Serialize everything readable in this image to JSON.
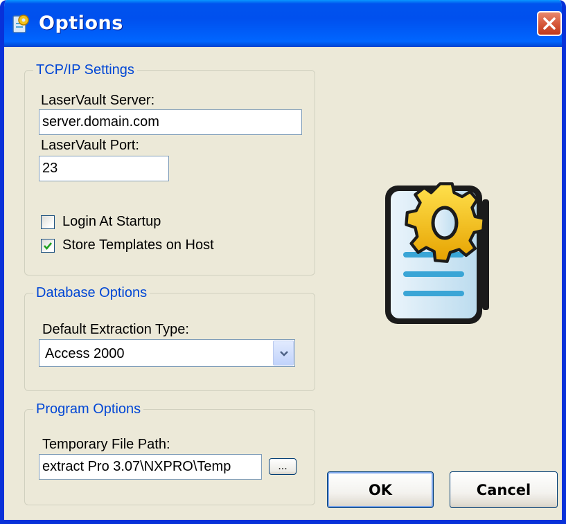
{
  "window": {
    "title": "Options",
    "icon": "options-app-icon",
    "close_icon": "close-icon"
  },
  "tcpip": {
    "legend": "TCP/IP Settings",
    "server_label": "LaserVault Server:",
    "server_value": "server.domain.com",
    "port_label": "LaserVault Port:",
    "port_value": "23",
    "login_at_startup_label": "Login At Startup",
    "login_at_startup_checked": false,
    "store_templates_label": "Store Templates on Host",
    "store_templates_checked": true
  },
  "database": {
    "legend": "Database Options",
    "extraction_type_label": "Default Extraction Type:",
    "extraction_type_value": "Access 2000"
  },
  "program": {
    "legend": "Program Options",
    "temp_path_label": "Temporary File Path:",
    "temp_path_value": "extract Pro 3.07\\NXPRO\\Temp",
    "browse_label": "..."
  },
  "buttons": {
    "ok": "OK",
    "cancel": "Cancel"
  },
  "illustration": "document-gear-icon",
  "colors": {
    "titlebar": "#0054e3",
    "window_bg": "#ece9d8",
    "legend_text": "#0046d5",
    "close_button": "#d75a3c"
  }
}
